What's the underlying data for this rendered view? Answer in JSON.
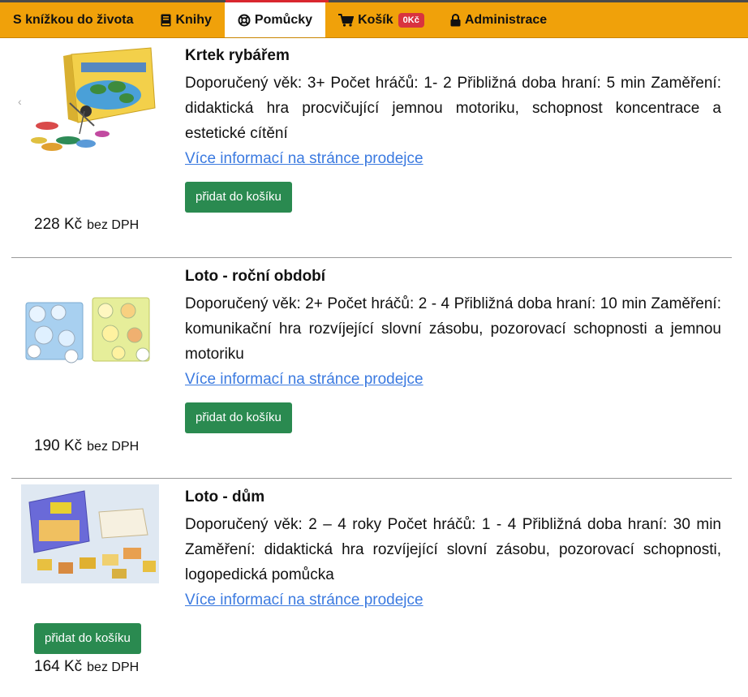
{
  "nav": {
    "brand": "S knížkou do života",
    "books": "Knihy",
    "aids": "Pomůcky",
    "cart": "Košík",
    "cart_badge": "0Kč",
    "admin": "Administrace"
  },
  "products": [
    {
      "title": "Krtek rybářem",
      "description": "Doporučený věk: 3+ Počet hráčů: 1- 2 Přibližná doba hraní: 5 min Zaměření: didaktická hra procvičující jemnou motoriku, schopnost koncentrace a estetické cítění",
      "link": "Více informací na stránce prodejce",
      "button": "přidat do košíku",
      "price": "228 Kč",
      "price_unit": "bez DPH"
    },
    {
      "title": "Loto - roční období",
      "description": "Doporučený věk: 2+ Počet hráčů: 2 - 4 Přibližná doba hraní: 10 min Zaměření: komunikační hra rozvíjející slovní zásobu, pozorovací schopnosti a jemnou motoriku",
      "link": "Více informací na stránce prodejce",
      "button": "přidat do košíku",
      "price": "190 Kč",
      "price_unit": "bez DPH"
    },
    {
      "title": "Loto - dům",
      "description": "Doporučený věk: 2 – 4 roky Počet hráčů: 1 - 4 Přibližná doba hraní: 30 min Zaměření: didaktická hra rozvíjející slovní zásobu, pozorovací schopnosti, logopedická pomůcka",
      "link": "Více informací na stránce prodejce",
      "button": "přidat do košíku",
      "price": "164 Kč",
      "price_unit": "bez DPH"
    }
  ],
  "icons": {
    "books": "book-icon",
    "aids": "lifebuoy-icon",
    "cart": "cart-icon",
    "admin": "lock-icon"
  },
  "colors": {
    "nav_bg": "#f0a10a",
    "button": "#2a8a50",
    "link": "#3b7ae0",
    "badge": "#d9333f"
  }
}
